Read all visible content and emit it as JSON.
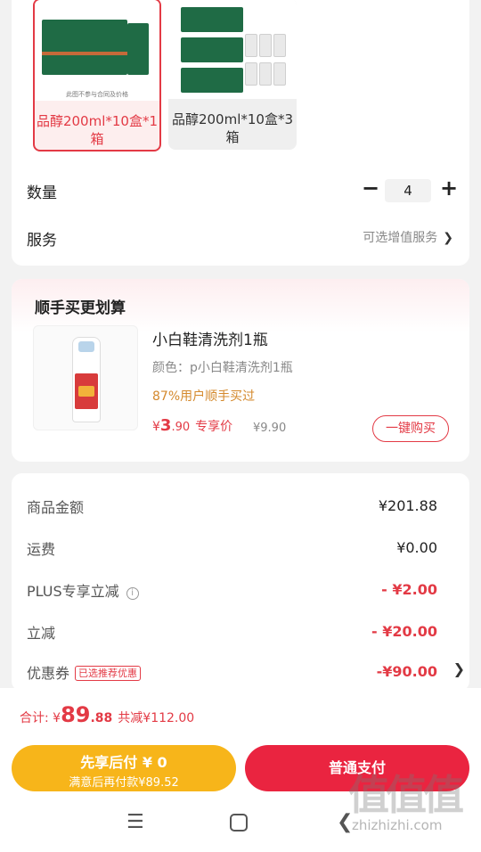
{
  "variants": [
    {
      "label": "品醇200ml*10盒*1箱",
      "selected": true,
      "image_caption": "此图不参与合同及价格"
    },
    {
      "label": "品醇200ml*10盒*3箱",
      "selected": false
    }
  ],
  "quantity": {
    "label": "数量",
    "minus": "−",
    "value": "4",
    "plus": "+"
  },
  "service": {
    "label": "服务",
    "hint": "可选增值服务",
    "chevron": "❯"
  },
  "upsell": {
    "title": "顺手买更划算",
    "product": {
      "name": "小白鞋清洗剂1瓶",
      "color": "颜色：p小白鞋清洗剂1瓶",
      "bought": "87%用户顺手买过",
      "price_currency": "¥",
      "price_int": "3",
      "price_dec": ".90",
      "price_tag": "专享价",
      "original_price": "¥9.90",
      "buy_button": "一键购买"
    }
  },
  "summary": {
    "goods_amount": {
      "label": "商品金额",
      "value": "¥201.88"
    },
    "shipping": {
      "label": "运费",
      "value": "¥0.00"
    },
    "plus_discount": {
      "label": "PLUS专享立减",
      "info": "i",
      "value": "- ¥2.00"
    },
    "discount": {
      "label": "立减",
      "value": "- ¥20.00"
    },
    "coupon": {
      "label": "优惠券",
      "badge": "已选推荐优惠",
      "value": "-¥90.00",
      "chevron": "❯"
    }
  },
  "footer": {
    "total_label": "合计: ¥",
    "total_int": "89",
    "total_dec": ".88",
    "saved": "共减¥112.00",
    "pay_later_line1": "先享后付 ¥ 0",
    "pay_later_line2": "满意后再付款¥89.52",
    "pay_normal": "普通支付"
  },
  "nav": {
    "menu": "☰",
    "back": "❮"
  },
  "watermark": {
    "big": "值值值",
    "small": "zhizhizhi.com"
  },
  "colors": {
    "accent_red": "#e33a45",
    "pay_red": "#ea2440",
    "pay_yellow": "#f7b51a",
    "price_orange": "#d4892d"
  }
}
